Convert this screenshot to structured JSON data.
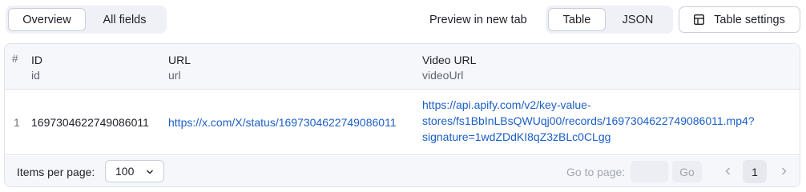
{
  "tabs": {
    "overview": "Overview",
    "all_fields": "All fields"
  },
  "preview_link": "Preview in new tab",
  "view_toggle": {
    "table": "Table",
    "json": "JSON"
  },
  "table_settings": {
    "label": "Table settings",
    "icon": "table-settings-icon"
  },
  "table": {
    "row_index_header": "#",
    "columns": [
      {
        "name": "ID",
        "key": "id"
      },
      {
        "name": "URL",
        "key": "url"
      },
      {
        "name": "Video URL",
        "key": "videoUrl"
      }
    ],
    "rows": [
      {
        "index": "1",
        "id": "1697304622749086011",
        "url": "https://x.com/X/status/1697304622749086011",
        "videoUrl_lines": [
          "https://api.apify.com/v2/key-value-",
          "stores/fs1BbInLBsQWUqj00/records/1697304622749086011.mp4?",
          "signature=1wdZDdKI8qZ3zBLc0CLgg"
        ]
      }
    ]
  },
  "pagination": {
    "items_per_page_label": "Items per page:",
    "items_per_page_value": "100",
    "goto_label": "Go to page:",
    "goto_value": "",
    "go_label": "Go",
    "current_page": "1"
  },
  "colors": {
    "link": "#1c5fc6",
    "header_bg": "#f6f7fa",
    "border": "#dfe2ea"
  }
}
